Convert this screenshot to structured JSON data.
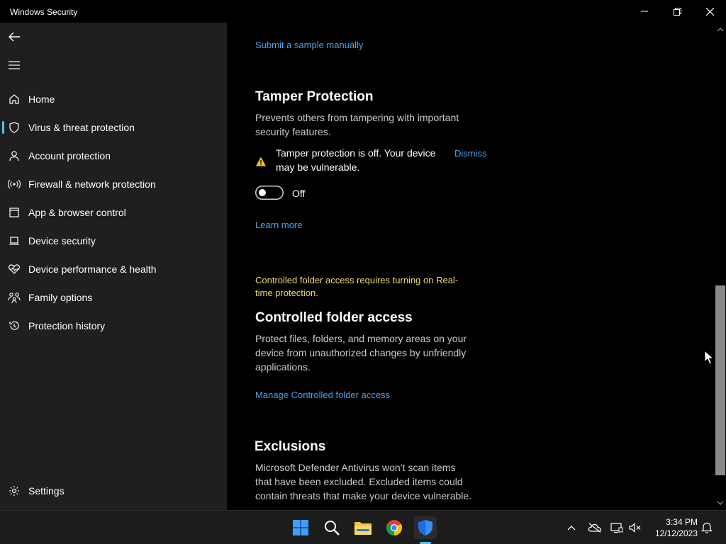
{
  "window": {
    "title": "Windows Security"
  },
  "sidebar": {
    "items": [
      {
        "label": "Home",
        "icon": "home-icon"
      },
      {
        "label": "Virus & threat protection",
        "icon": "shield-icon",
        "selected": true
      },
      {
        "label": "Account protection",
        "icon": "person-icon"
      },
      {
        "label": "Firewall & network protection",
        "icon": "wifi-broadcast-icon"
      },
      {
        "label": "App & browser control",
        "icon": "app-window-icon"
      },
      {
        "label": "Device security",
        "icon": "laptop-icon"
      },
      {
        "label": "Device performance & health",
        "icon": "heart-pulse-icon"
      },
      {
        "label": "Family options",
        "icon": "family-icon"
      },
      {
        "label": "Protection history",
        "icon": "history-icon"
      }
    ],
    "settings_label": "Settings"
  },
  "main": {
    "submit_sample_link": "Submit a sample manually",
    "tamper": {
      "heading": "Tamper Protection",
      "description_line1": "Prevents others from tampering with important",
      "description_line2": "security features.",
      "warning_line1": "Tamper protection is off. Your device",
      "warning_line2": "may be vulnerable.",
      "dismiss_label": "Dismiss",
      "toggle_state_label": "Off",
      "learn_more_label": "Learn more"
    },
    "cfa": {
      "notice_line1": "Controlled folder access requires turning on Real-",
      "notice_line2": "time protection.",
      "heading": "Controlled folder access",
      "description_line1": "Protect files, folders, and memory areas on your",
      "description_line2": "device from unauthorized changes by unfriendly",
      "description_line3": "applications.",
      "manage_link": "Manage Controlled folder access"
    },
    "exclusions": {
      "heading": "Exclusions",
      "description_line1": "Microsoft Defender Antivirus won’t scan items",
      "description_line2": "that have been excluded. Excluded items could",
      "description_line3": "contain threats that make your device vulnerable."
    }
  },
  "taskbar": {
    "time": "3:34 PM",
    "date": "12/12/2023"
  },
  "colors": {
    "accent": "#4cc2ff",
    "link": "#4ca0e6",
    "warning_text": "#f1d96b",
    "warning_icon": "#f2c418",
    "sidebar_bg": "#1f1f1f"
  }
}
